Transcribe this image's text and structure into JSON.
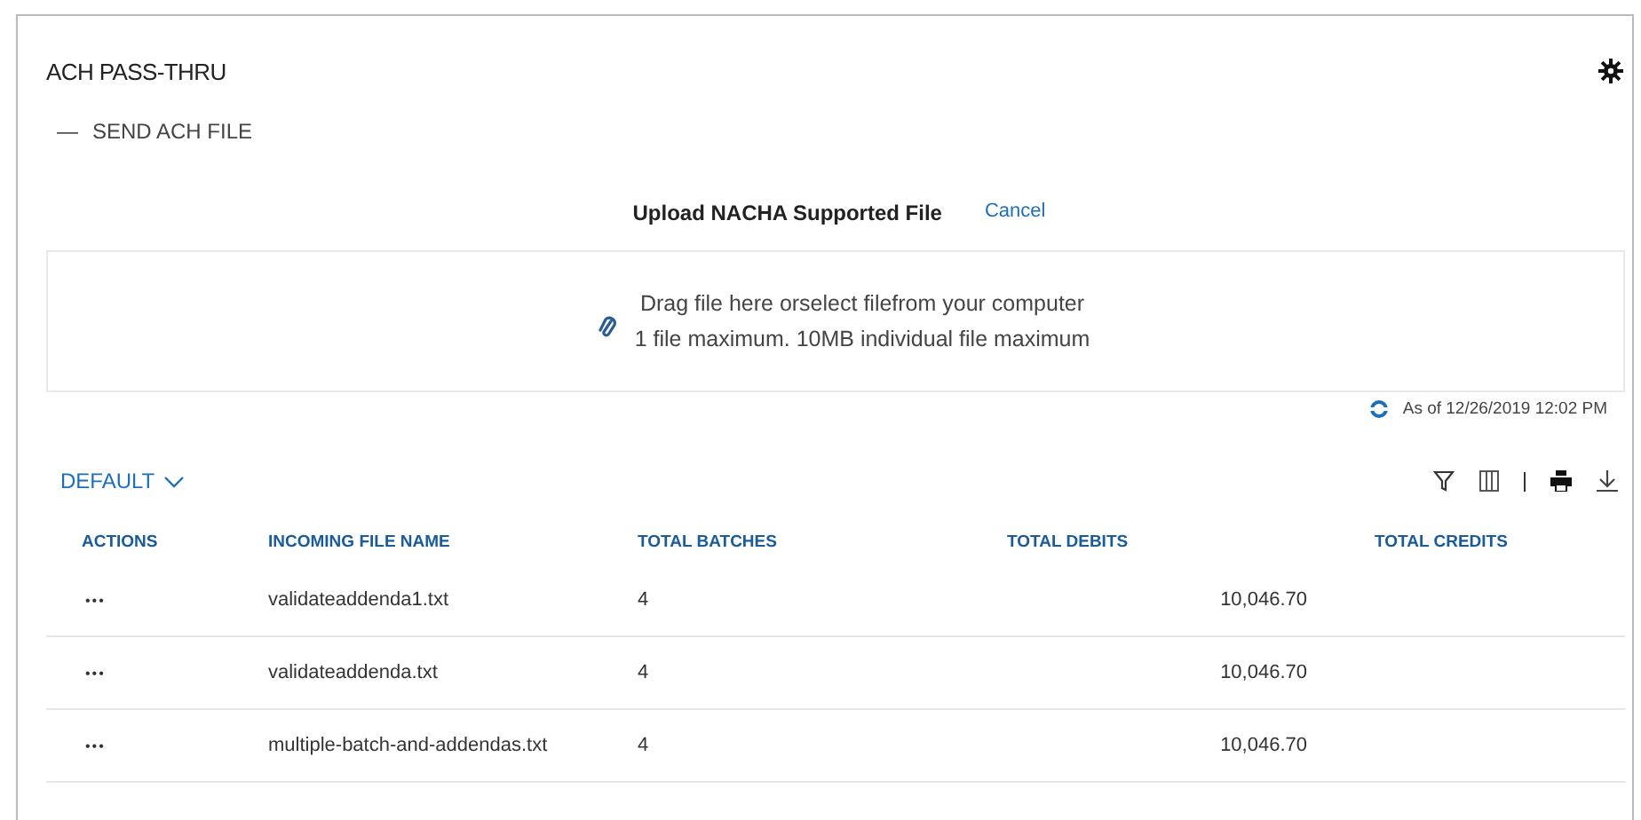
{
  "panel": {
    "title": "ACH PASS-THRU"
  },
  "section": {
    "toggle": "—",
    "title": "SEND ACH FILE"
  },
  "upload": {
    "title": "Upload NACHA Supported File",
    "cancel": "Cancel",
    "line_1": "Drag file here orselect filefrom your computer",
    "line_2": "1 file maximum. 10MB individual file maximum"
  },
  "as_of": "As of 12/26/2019 12:02 PM",
  "view": {
    "label": "DEFAULT"
  },
  "table": {
    "columns": [
      "ACTIONS",
      "INCOMING FILE NAME",
      "TOTAL BATCHES",
      "TOTAL DEBITS",
      "TOTAL CREDITS"
    ],
    "rows": [
      {
        "actions": "•••",
        "file_name": "validateaddenda1.txt",
        "batches": "4",
        "debits": "10,046.70"
      },
      {
        "actions": "•••",
        "file_name": "validateaddenda.txt",
        "batches": "4",
        "debits": "10,046.70"
      },
      {
        "actions": "•••",
        "file_name": "multiple-batch-and-addendas.txt",
        "batches": "4",
        "debits": "10,046.70"
      }
    ]
  }
}
